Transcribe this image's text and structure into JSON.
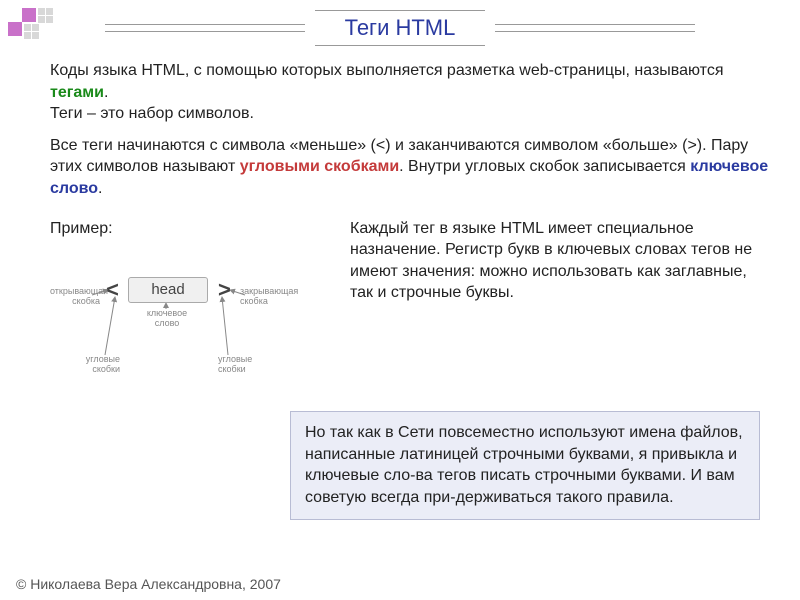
{
  "logo": {
    "shape": "squares"
  },
  "title": "Теги HTML",
  "para1_a": "Коды языка HTML, с помощью которых выполняется разметка web-страницы, называются ",
  "para1_tag": "тегами",
  "para1_b": ".",
  "para1_c": "Теги – это набор символов.",
  "para2_a": "Все теги начинаются с символа «меньше» (<) и заканчиваются символом «больше» (>). Пару этих символов называют ",
  "para2_term1": "угловыми скобками",
  "para2_b": ". Внутри угловых скобок записывается ",
  "para2_term2": "ключевое слово",
  "para2_c": ".",
  "example_label": "Пример:",
  "diagram": {
    "lt": "<",
    "head": "head",
    "gt": ">",
    "open_bracket": "открывающая скобка",
    "close_bracket": "закрывающая скобка",
    "keyword": "ключевое слово",
    "angle1": "угловые скобки",
    "angle2": "угловые скобки"
  },
  "para3": "Каждый тег в языке HTML имеет специальное назначение. Регистр букв в ключевых словах тегов не имеют значения: можно использовать как заглавные, так и строчные буквы.",
  "highlight": "Но так как в Сети повсеместно используют имена файлов, написанные латиницей строчными буквами, я привыкла и ключевые сло-ва тегов писать строчными буквами. И вам советую всегда при-держиваться такого правила.",
  "footer": "© Николаева Вера Александровна, 2007"
}
